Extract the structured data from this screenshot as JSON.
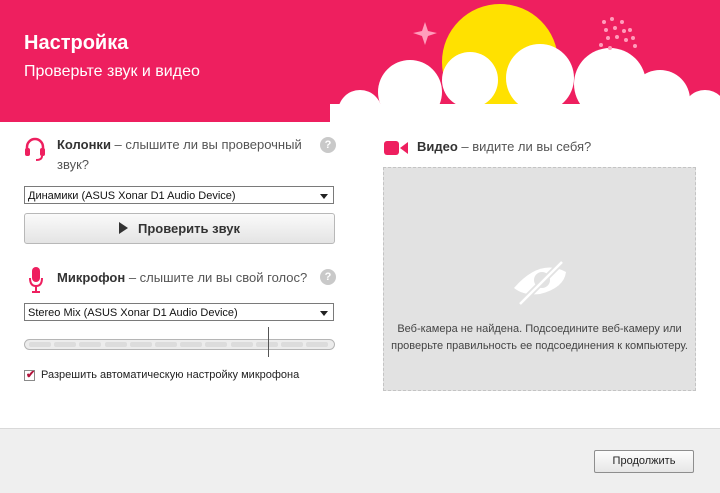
{
  "header": {
    "title": "Настройка",
    "subtitle": "Проверьте звук и видео",
    "accent_color": "#ee1f5f"
  },
  "speakers": {
    "icon": "headset-icon",
    "label_bold": "Колонки",
    "label_rest": " – слышите ли вы проверочный звук?",
    "device": "Динамики (ASUS Xonar D1 Audio Device)",
    "test_button": "Проверить звук",
    "help": "?"
  },
  "microphone": {
    "icon": "microphone-icon",
    "label_bold": "Микрофон",
    "label_rest": " – слышите ли вы свой голос?",
    "device": "Stereo Mix (ASUS Xonar D1 Audio Device)",
    "level": 0.79,
    "help": "?",
    "auto_adjust_checked": true,
    "auto_adjust_label": "Разрешить автоматическую настройку микрофона"
  },
  "video": {
    "icon": "camera-icon",
    "label_bold": "Видео",
    "label_rest": " – видите ли вы себя?",
    "message": "Веб-камера не найдена. Подсоедините веб-камеру или проверьте правильность ее подсоединения к компьютеру."
  },
  "footer": {
    "continue_button": "Продолжить"
  }
}
